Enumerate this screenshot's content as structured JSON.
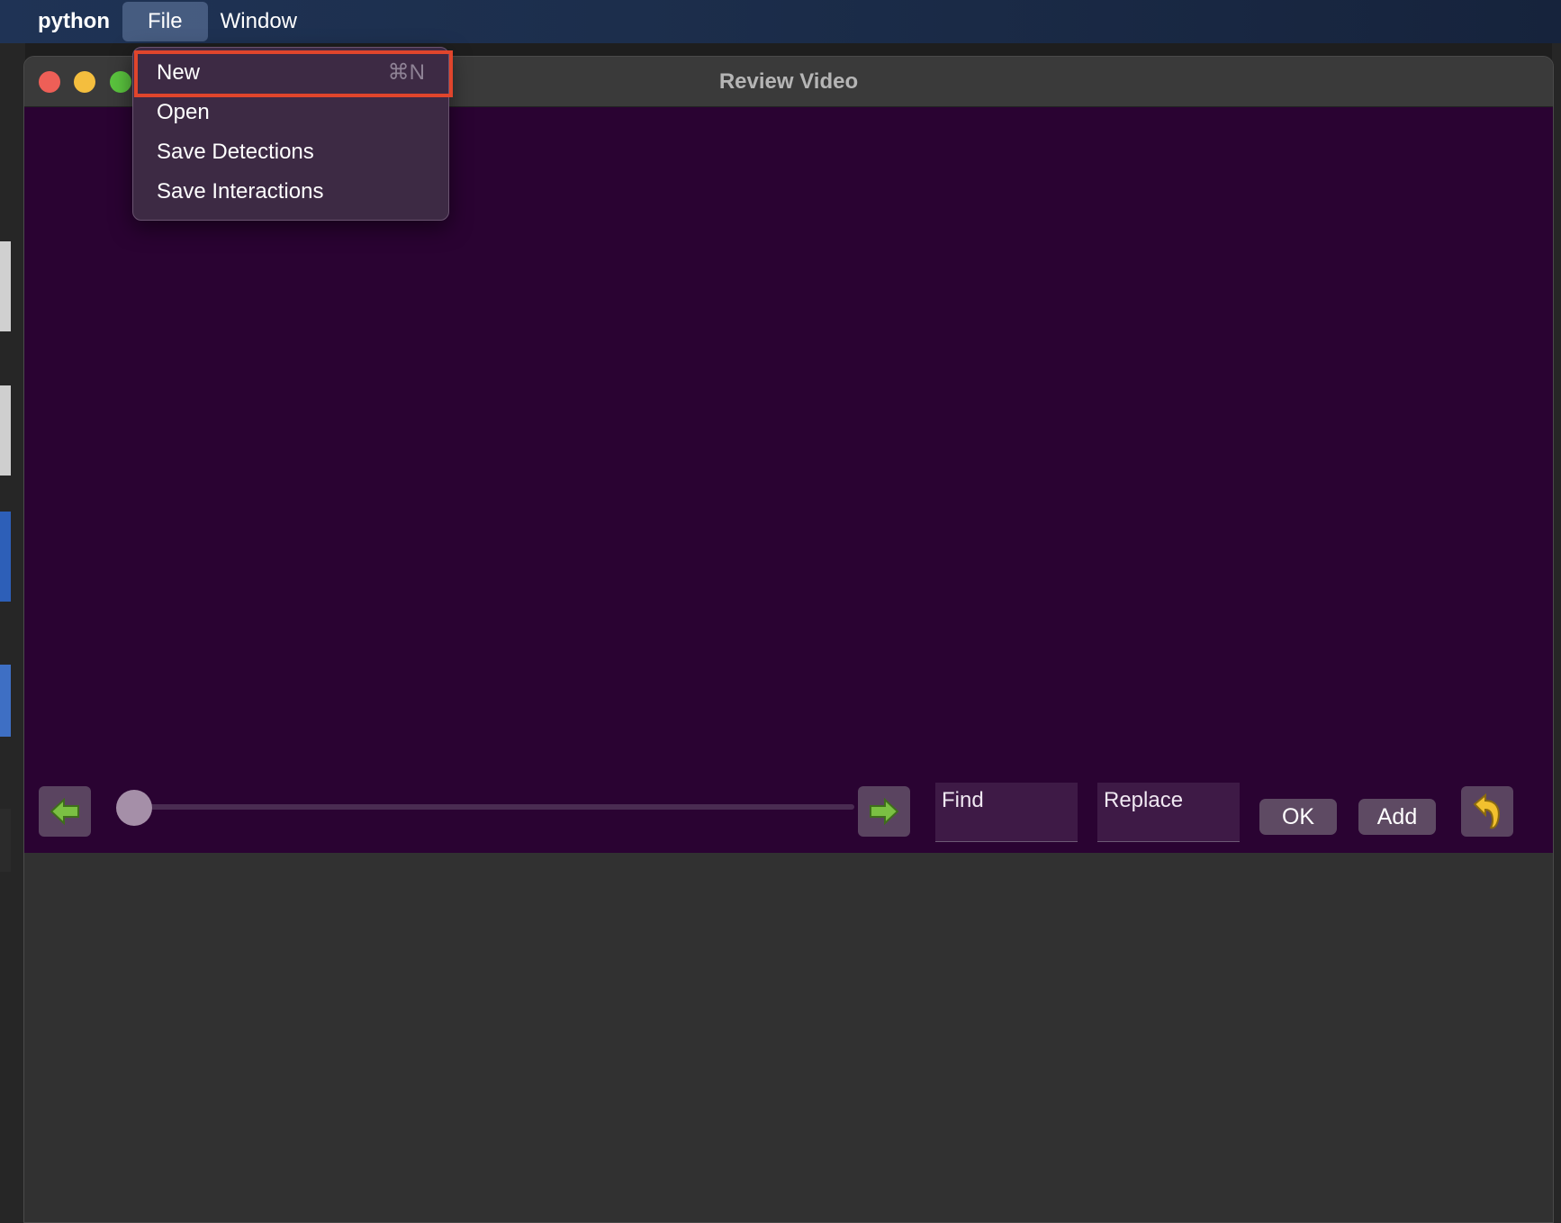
{
  "menubar": {
    "app_name": "python",
    "items": [
      {
        "label": "File"
      },
      {
        "label": "Window"
      }
    ]
  },
  "window": {
    "title": "Review Video"
  },
  "file_menu": {
    "items": [
      {
        "label": "New",
        "shortcut": "⌘N"
      },
      {
        "label": "Open"
      },
      {
        "label": "Save Detections"
      },
      {
        "label": "Save Interactions"
      }
    ]
  },
  "controls": {
    "find_value": "Find",
    "replace_value": "Replace",
    "ok_label": "OK",
    "add_label": "Add",
    "slider_position": 0
  },
  "icons": {
    "prev": "left-arrow-icon",
    "next": "right-arrow-icon",
    "undo": "undo-arrow-icon"
  },
  "colors": {
    "video_bg": "#2a0332",
    "highlight": "#e0452c",
    "arrow_green": "#7bc043",
    "undo_yellow": "#f2c12e"
  }
}
